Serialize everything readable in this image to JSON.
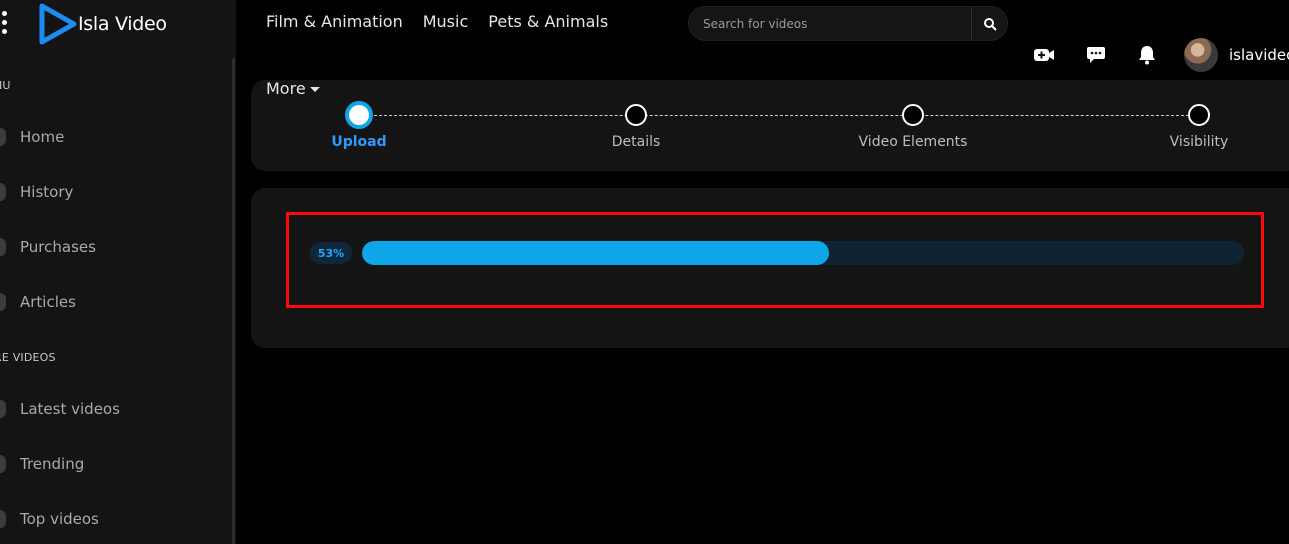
{
  "app": {
    "name": "Isla Video"
  },
  "sidebar": {
    "section_menu": "NU",
    "section_more": "RE VIDEOS",
    "items_menu": [
      {
        "label": "Home",
        "icon": "home-icon"
      },
      {
        "label": "History",
        "icon": "history-icon"
      },
      {
        "label": "Purchases",
        "icon": "purchases-icon"
      },
      {
        "label": "Articles",
        "icon": "articles-icon"
      }
    ],
    "items_more": [
      {
        "label": "Latest videos",
        "icon": "latest-icon"
      },
      {
        "label": "Trending",
        "icon": "trending-icon"
      },
      {
        "label": "Top videos",
        "icon": "top-icon"
      }
    ]
  },
  "header": {
    "nav": [
      "Film & Animation",
      "Music",
      "Pets & Animals"
    ],
    "more_label": "More",
    "search_placeholder": "Search for videos",
    "username": "islavideo"
  },
  "steps": [
    {
      "label": "Upload",
      "active": true
    },
    {
      "label": "Details",
      "active": false
    },
    {
      "label": "Video Elements",
      "active": false
    },
    {
      "label": "Visibility",
      "active": false
    }
  ],
  "upload": {
    "progress_label": "53%",
    "progress_value": 53
  },
  "colors": {
    "accent": "#0ea5e9",
    "highlight": "#ff0a0a"
  }
}
